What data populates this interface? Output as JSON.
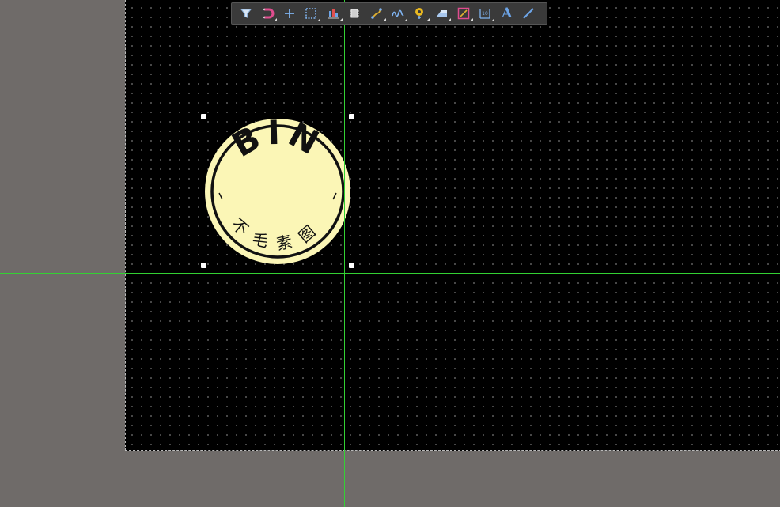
{
  "colors": {
    "workspace": "#6f6b69",
    "board": "#000000",
    "guide": "#33d133",
    "toolbar_bg": "#3a3a3a",
    "stamp_fill": "#fbf6b6",
    "stamp_ink": "#111111"
  },
  "toolbar": {
    "items": [
      {
        "icon": "filter-icon"
      },
      {
        "icon": "magnet-icon"
      },
      {
        "icon": "crosshair-icon"
      },
      {
        "icon": "select-rectangle-icon"
      },
      {
        "icon": "align-chart-icon"
      },
      {
        "icon": "component-chip-icon"
      },
      {
        "icon": "route-track-icon"
      },
      {
        "icon": "interactive-route-icon"
      },
      {
        "icon": "place-pad-icon"
      },
      {
        "icon": "polygon-pour-icon"
      },
      {
        "icon": "keepout-icon"
      },
      {
        "icon": "dimension-icon"
      },
      {
        "icon": "text-icon",
        "label": "A"
      },
      {
        "icon": "line-icon"
      }
    ]
  },
  "stamp": {
    "top_text": "BIN",
    "bottom_text": "不毛素图"
  }
}
